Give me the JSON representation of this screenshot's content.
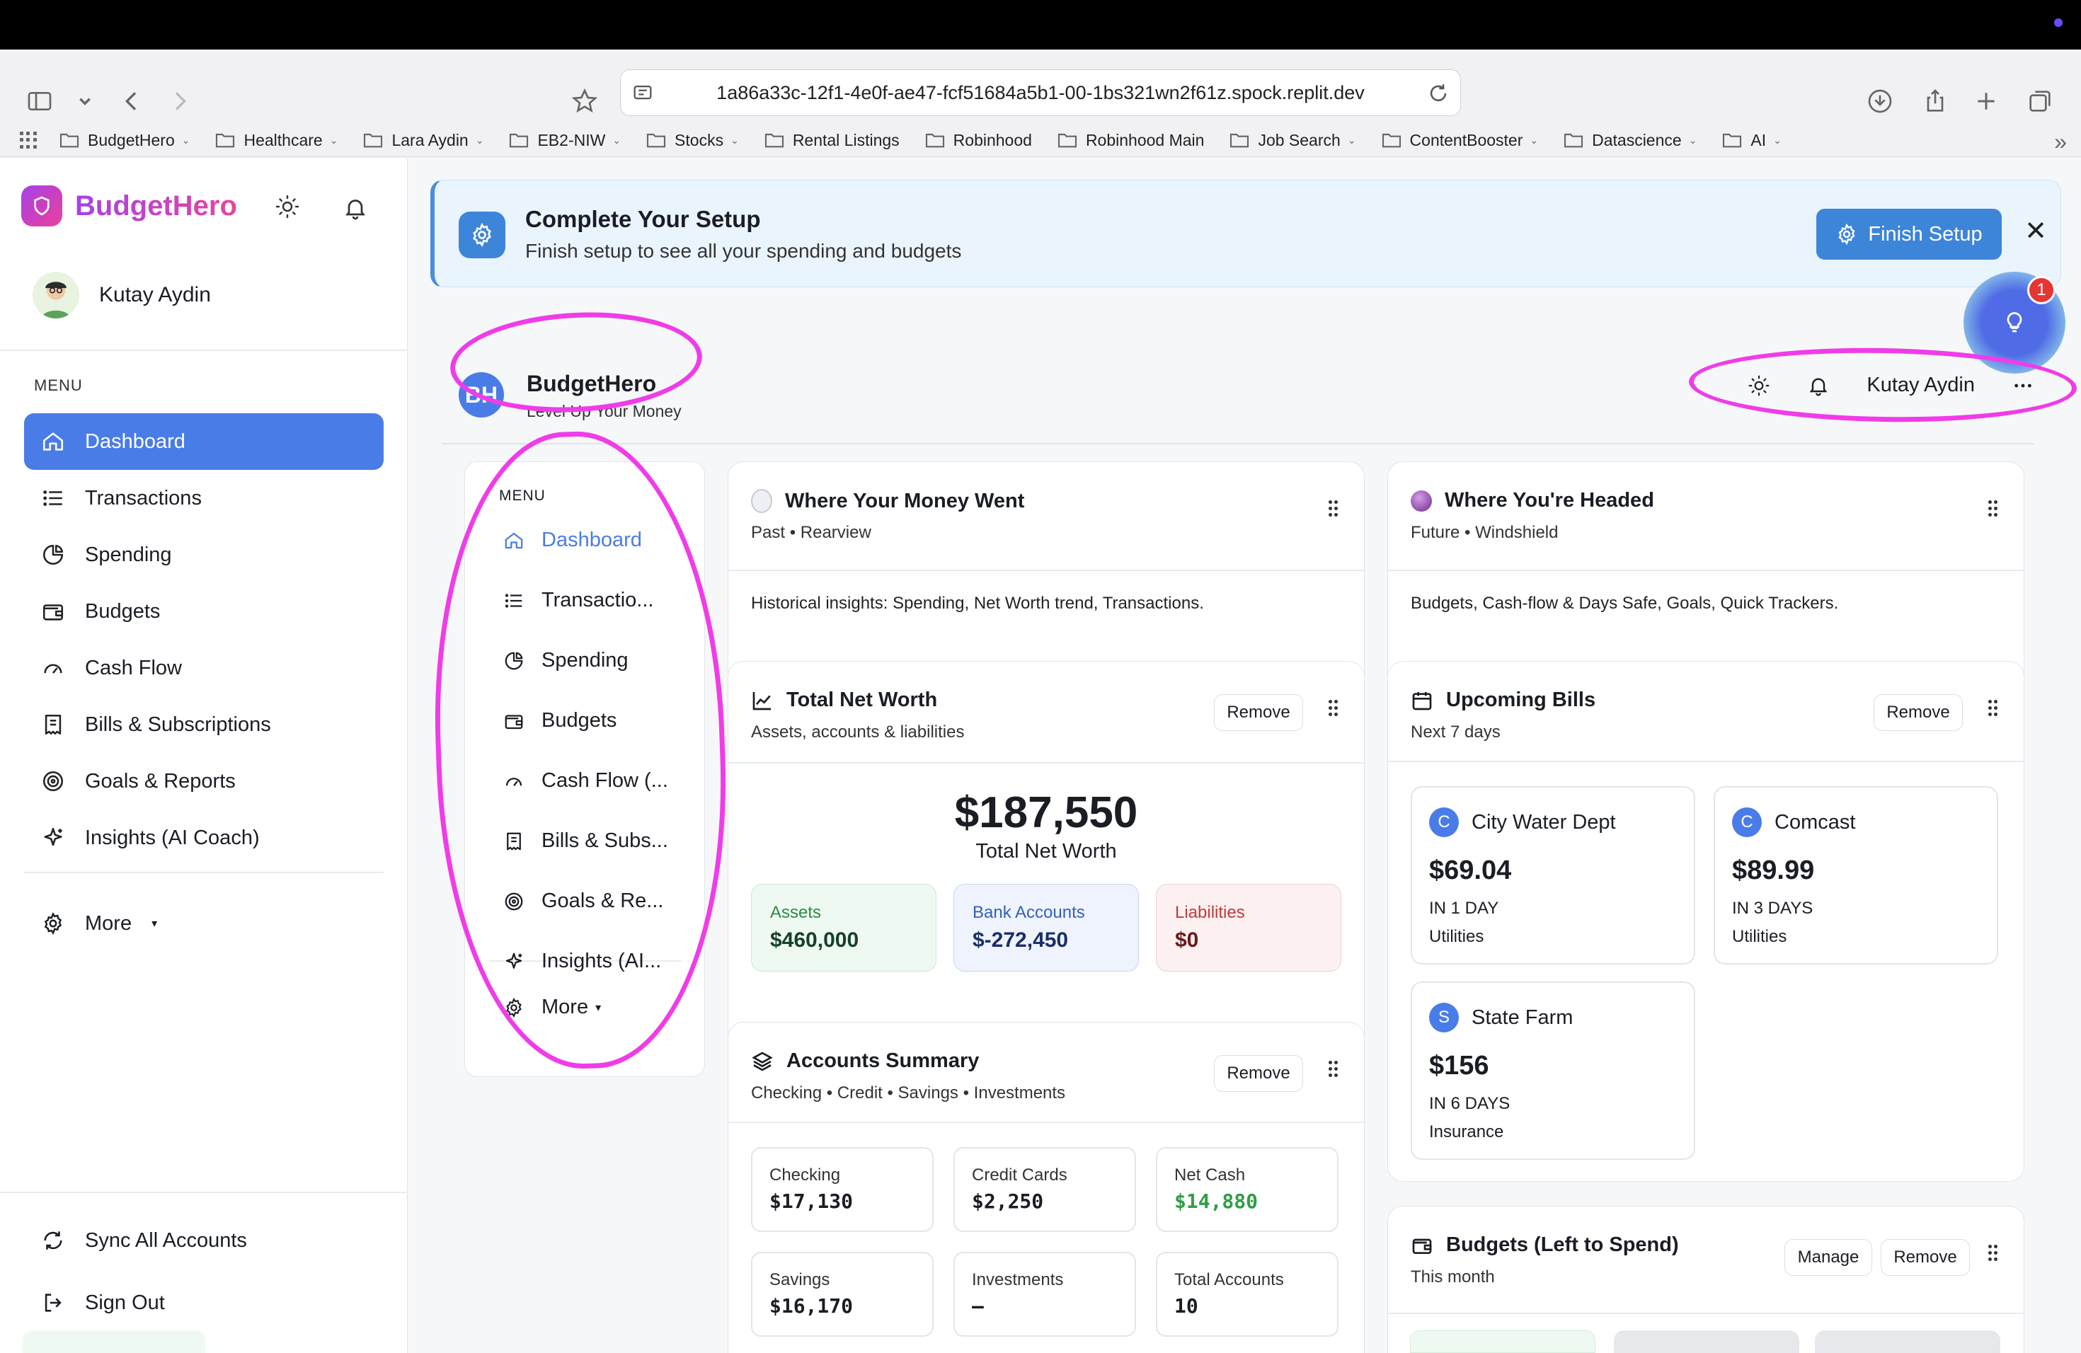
{
  "browser": {
    "url": "1a86a33c-12f1-4e0f-ae47-fcf51684a5b1-00-1bs321wn2f61z.spock.replit.dev",
    "bookmarks": [
      {
        "label": "BudgetHero",
        "caret": true
      },
      {
        "label": "Healthcare",
        "caret": true
      },
      {
        "label": "Lara Aydin",
        "caret": true
      },
      {
        "label": "EB2-NIW",
        "caret": true
      },
      {
        "label": "Stocks",
        "caret": true
      },
      {
        "label": "Rental Listings",
        "caret": false
      },
      {
        "label": "Robinhood",
        "caret": false
      },
      {
        "label": "Robinhood Main",
        "caret": false
      },
      {
        "label": "Job Search",
        "caret": true
      },
      {
        "label": "ContentBooster",
        "caret": true
      },
      {
        "label": "Datascience",
        "caret": true
      },
      {
        "label": "AI",
        "caret": true
      }
    ]
  },
  "sidebar": {
    "brand": "BudgetHero",
    "user_name": "Kutay Aydin",
    "menu_label": "MENU",
    "items": [
      {
        "label": "Dashboard",
        "icon": "home-icon"
      },
      {
        "label": "Transactions",
        "icon": "list-icon"
      },
      {
        "label": "Spending",
        "icon": "pie-icon"
      },
      {
        "label": "Budgets",
        "icon": "wallet-icon"
      },
      {
        "label": "Cash Flow",
        "icon": "gauge-icon"
      },
      {
        "label": "Bills & Subscriptions",
        "icon": "receipt-icon"
      },
      {
        "label": "Goals & Reports",
        "icon": "target-icon"
      },
      {
        "label": "Insights (AI Coach)",
        "icon": "sparkles-icon"
      }
    ],
    "more": "More",
    "sync": "Sync All Accounts",
    "sign_out": "Sign Out"
  },
  "banner": {
    "title": "Complete Your Setup",
    "subtitle": "Finish setup to see all your spending and budgets",
    "button": "Finish Setup",
    "close": "✕"
  },
  "coach_badge": "1",
  "inner_header": {
    "badge": "BH",
    "title": "BudgetHero",
    "subtitle": "Level Up Your Money",
    "user_name": "Kutay Aydin"
  },
  "inner_nav": {
    "menu_label": "MENU",
    "items": [
      "Dashboard",
      "Transactio...",
      "Spending",
      "Budgets",
      "Cash Flow (...",
      "Bills & Subs...",
      "Goals & Re...",
      "Insights (AI..."
    ],
    "more": "More"
  },
  "cards": {
    "past": {
      "title": "Where Your Money Went",
      "subtitle": "Past • Rearview",
      "body": "Historical insights: Spending, Net Worth trend, Transactions."
    },
    "future": {
      "title": "Where You're Headed",
      "subtitle": "Future • Windshield",
      "body": "Budgets, Cash-flow & Days Safe, Goals, Quick Trackers."
    },
    "net_worth": {
      "title": "Total Net Worth",
      "subtitle": "Assets, accounts & liabilities",
      "remove": "Remove",
      "value": "$187,550",
      "value_label": "Total Net Worth",
      "assets_label": "Assets",
      "assets": "$460,000",
      "bank_label": "Bank Accounts",
      "bank": "$-272,450",
      "liab_label": "Liabilities",
      "liab": "$0"
    },
    "accounts": {
      "title": "Accounts Summary",
      "subtitle": "Checking • Credit • Savings • Investments",
      "remove": "Remove",
      "items": [
        {
          "label": "Checking",
          "value": "$17,130"
        },
        {
          "label": "Credit Cards",
          "value": "$2,250"
        },
        {
          "label": "Net Cash",
          "value": "$14,880"
        },
        {
          "label": "Savings",
          "value": "$16,170"
        },
        {
          "label": "Investments",
          "value": "—"
        },
        {
          "label": "Total Accounts",
          "value": "10"
        }
      ]
    },
    "bills": {
      "title": "Upcoming Bills",
      "subtitle": "Next 7 days",
      "remove": "Remove",
      "items": [
        {
          "initial": "C",
          "name": "City Water Dept",
          "amount": "$69.04",
          "due": "IN 1 DAY",
          "category": "Utilities"
        },
        {
          "initial": "C",
          "name": "Comcast",
          "amount": "$89.99",
          "due": "IN 3 DAYS",
          "category": "Utilities"
        },
        {
          "initial": "S",
          "name": "State Farm",
          "amount": "$156",
          "due": "IN 6 DAYS",
          "category": "Insurance"
        }
      ]
    },
    "budgets": {
      "title": "Budgets (Left to Spend)",
      "subtitle": "This month",
      "manage": "Manage",
      "remove": "Remove"
    }
  },
  "colors": {
    "accent": "#4a7ce8",
    "brand_gradient_start": "#a542e8",
    "brand_gradient_end": "#e8459d",
    "highlight": "#f03ce8",
    "positive": "#2e9e45"
  }
}
